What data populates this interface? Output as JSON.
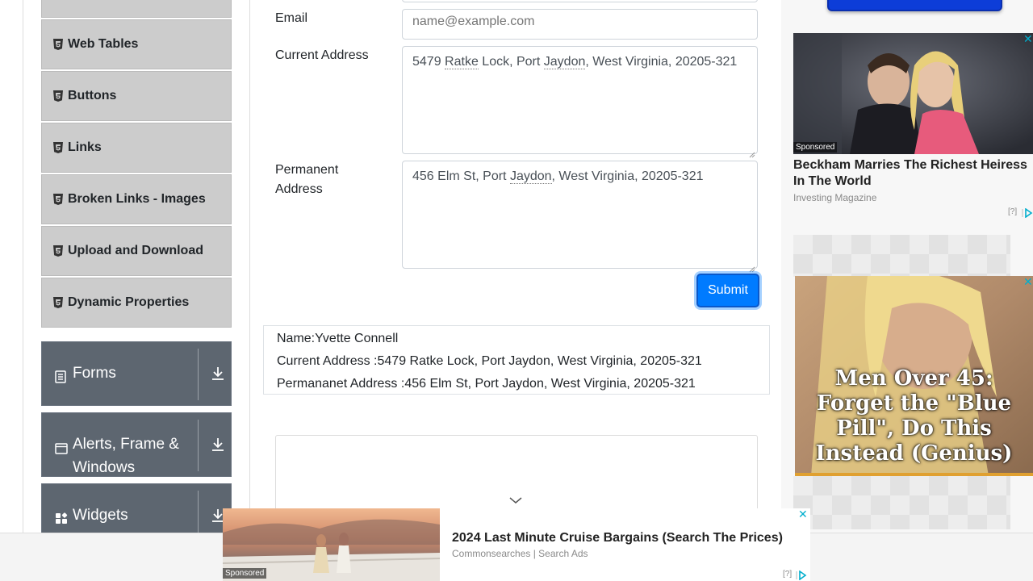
{
  "sidebar": {
    "sub_items": [
      {
        "label": ""
      },
      {
        "label": "Web Tables"
      },
      {
        "label": "Buttons"
      },
      {
        "label": "Links"
      },
      {
        "label": "Broken Links - Images"
      },
      {
        "label": "Upload and Download"
      },
      {
        "label": "Dynamic Properties"
      }
    ],
    "groups": [
      {
        "label": "Forms",
        "icon": "document-icon"
      },
      {
        "label": "Alerts, Frame & Windows",
        "icon": "window-icon"
      },
      {
        "label": "Widgets",
        "icon": "widgets-icon"
      }
    ]
  },
  "form": {
    "email_label": "Email",
    "email_placeholder": "name@example.com",
    "current_address_label": "Current Address",
    "current_address_value": {
      "p1": "5479 ",
      "u1": "Ratke",
      "p2": " Lock, Port ",
      "u2": "Jaydon",
      "p3": ", West Virginia, 20205-321"
    },
    "permanent_address_label_1": "Permanent",
    "permanent_address_label_2": "Address",
    "permanent_address_value": {
      "p1": "456 Elm St, Port ",
      "u1": "Jaydon",
      "p2": ", West Virginia, 20205-321"
    },
    "submit_label": "Submit"
  },
  "output": {
    "name": "Name:Yvette Connell",
    "current_address": "Current Address :5479 Ratke Lock, Port Jaydon, West Virginia, 20205-321",
    "permanent_address": "Permananet Address :456 Elm St, Port Jaydon, West Virginia, 20205-321"
  },
  "ads": {
    "right_ad_1": {
      "sponsored": "Sponsored",
      "title": "Beckham Marries The Richest Heiress In The World",
      "source": "Investing Magazine",
      "adchoice": "[?]"
    },
    "right_ad_2": {
      "headline": "Men Over 45: Forget the \"Blue Pill\", Do This Instead (Genius)"
    },
    "bottom_ad": {
      "sponsored": "Sponsored",
      "title": "2024 Last Minute Cruise Bargains (Search The Prices)",
      "source": "Commonsearches | Search Ads",
      "adchoice": "[?]"
    },
    "close_glyph": "✕"
  },
  "colors": {
    "accent": "#007bff",
    "sidebar_group": "#5d6670",
    "sidebar_item": "#cccccc",
    "ad_close": "#00aecd"
  }
}
